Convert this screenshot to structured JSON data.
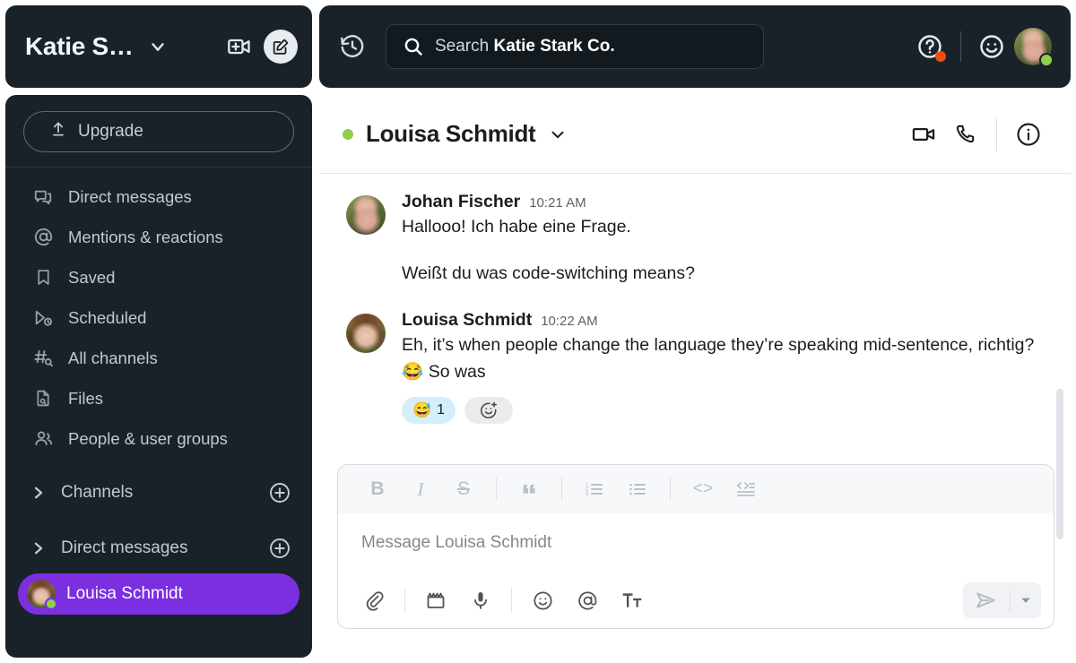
{
  "workspace": {
    "name": "Katie S…",
    "chevron_icon": "chevron-down-icon",
    "new_call_icon": "new-video-call-icon",
    "compose_icon": "compose-message-icon"
  },
  "sidebar": {
    "upgrade": {
      "label": "Upgrade",
      "icon": "upgrade-arrow-icon"
    },
    "items": [
      {
        "label": "Direct messages",
        "icon": "direct-messages-icon"
      },
      {
        "label": "Mentions & reactions",
        "icon": "at-mention-icon"
      },
      {
        "label": "Saved",
        "icon": "bookmark-icon"
      },
      {
        "label": "Scheduled",
        "icon": "scheduled-send-icon"
      },
      {
        "label": "All channels",
        "icon": "channel-search-icon"
      },
      {
        "label": "Files",
        "icon": "file-search-icon"
      },
      {
        "label": "People & user groups",
        "icon": "people-icon"
      }
    ],
    "sections": [
      {
        "label": "Channels",
        "caret_icon": "chevron-right-icon",
        "add_icon": "plus-circle-icon"
      },
      {
        "label": "Direct messages",
        "caret_icon": "chevron-right-icon",
        "add_icon": "plus-circle-icon"
      }
    ],
    "selected_dm": {
      "name": "Louisa Schmidt",
      "presence": "active",
      "highlight_color": "#7b2fe0"
    }
  },
  "topbar": {
    "history_icon": "history-clock-icon",
    "search": {
      "icon": "search-icon",
      "prefix": "Search",
      "scope": "Katie Stark Co."
    },
    "help_icon": "help-circle-icon",
    "help_badge_color": "#f24d0d",
    "emoji_icon": "smiley-face-icon",
    "avatar_icon": "user-avatar",
    "presence_color": "#8ed04a"
  },
  "conversation": {
    "title": "Louisa Schmidt",
    "presence": "active",
    "presence_color": "#8ed04a",
    "chevron_icon": "chevron-down-icon",
    "actions": [
      {
        "icon": "video-call-icon"
      },
      {
        "icon": "phone-call-icon"
      },
      {
        "icon": "info-circle-icon"
      }
    ]
  },
  "messages": [
    {
      "author": "Johan Fischer",
      "time": "10:21 AM",
      "avatar": "johan-avatar",
      "lines": [
        "Hallooo! Ich habe eine Frage.",
        "Weißt du was code-switching means?"
      ],
      "reactions": []
    },
    {
      "author": "Louisa Schmidt",
      "time": "10:22 AM",
      "avatar": "louisa-avatar",
      "lines": [
        "Eh, it’s when people change the language they’re speaking mid-sentence, richtig? 😂 So was"
      ],
      "reactions": [
        {
          "emoji": "😅",
          "count": "1",
          "background": "#d4eefb"
        }
      ],
      "add_reaction_icon": "add-reaction-icon"
    }
  ],
  "composer": {
    "placeholder": "Message Louisa Schmidt",
    "format_buttons": [
      {
        "icon": "bold-icon",
        "label": "B"
      },
      {
        "icon": "italic-icon",
        "label": "I"
      },
      {
        "icon": "strikethrough-icon",
        "label": "S"
      },
      {
        "icon": "blockquote-icon",
        "label": "”"
      },
      {
        "icon": "ordered-list-icon",
        "label": ""
      },
      {
        "icon": "bulleted-list-icon",
        "label": ""
      },
      {
        "icon": "inline-code-icon",
        "label": "<>"
      },
      {
        "icon": "code-block-icon",
        "label": ""
      }
    ],
    "action_buttons": [
      {
        "icon": "attach-paperclip-icon"
      },
      {
        "icon": "video-clip-icon"
      },
      {
        "icon": "microphone-icon"
      },
      {
        "icon": "emoji-icon"
      },
      {
        "icon": "mention-at-icon"
      },
      {
        "icon": "text-formatting-icon"
      }
    ],
    "send_icon": "send-arrow-icon",
    "send_options_icon": "chevron-down-icon"
  }
}
